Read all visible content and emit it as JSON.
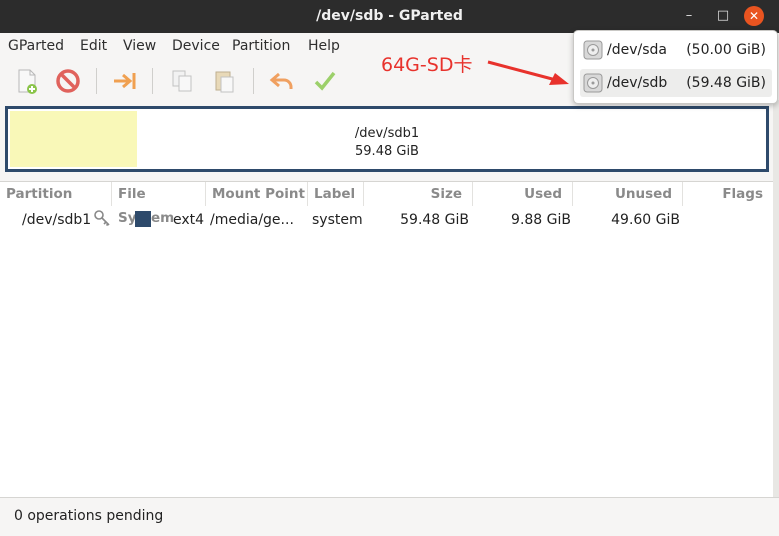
{
  "window": {
    "title": "/dev/sdb - GParted",
    "minimize": "–",
    "maximize": "□",
    "close": "✕"
  },
  "menubar": [
    "GParted",
    "Edit",
    "View",
    "Device",
    "Partition",
    "Help"
  ],
  "toolbar": {
    "items": [
      "new-partition-icon",
      "delete-icon",
      "resize-move-icon",
      "copy-icon",
      "paste-icon",
      "undo-icon",
      "apply-icon"
    ]
  },
  "diskmap": {
    "partition": "/dev/sdb1",
    "size": "59.48 GiB",
    "used_fraction": 0.166
  },
  "table": {
    "columns": [
      "Partition",
      "File System",
      "Mount Point",
      "Label",
      "Size",
      "Used",
      "Unused",
      "Flags"
    ],
    "rows": [
      {
        "partition": "/dev/sdb1",
        "filesystem": "ext4",
        "mount_point": "/media/ge...",
        "label": "system",
        "size": "59.48 GiB",
        "used": "9.88 GiB",
        "unused": "49.60 GiB",
        "flags": ""
      }
    ]
  },
  "device_popup": {
    "items": [
      {
        "name": "/dev/sda",
        "size": "(50.00 GiB)"
      },
      {
        "name": "/dev/sdb",
        "size": "(59.48 GiB)"
      }
    ]
  },
  "annotation": {
    "text": "64G-SD卡",
    "color": "#e8322c"
  },
  "status": {
    "text": "0 operations pending"
  },
  "colors": {
    "titlebar": "#2c2c2c",
    "close_button": "#e95420",
    "ext4": "#2e4a6b",
    "used_space": "#f9f8b8"
  }
}
